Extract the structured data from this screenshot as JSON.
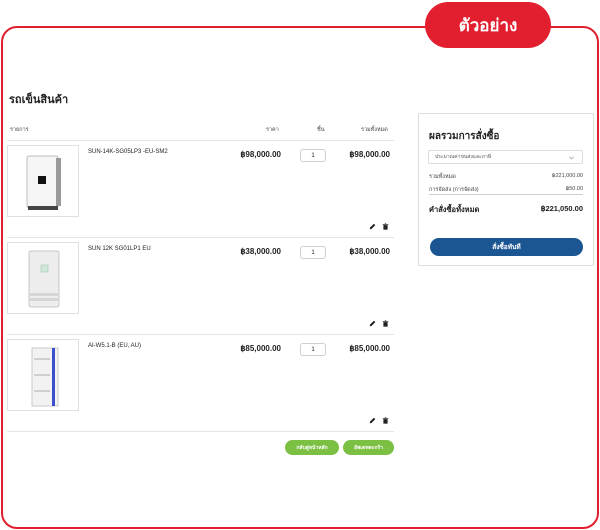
{
  "badge": {
    "label": "ตัวอย่าง"
  },
  "cart": {
    "title": "รถเข็นสินค้า",
    "columns": {
      "item": "รายการ",
      "price": "ราคา",
      "qty": "ชิ้น",
      "total": "รวมทั้งหมด"
    },
    "items": [
      {
        "name": "SUN-14K-SG05LP3 -EU-SM2",
        "price": "฿98,000.00",
        "qty": "1",
        "total": "฿98,000.00",
        "image_icon": "inverter-black-screen"
      },
      {
        "name": "SUN 12K SG01LP1 EU",
        "price": "฿38,000.00",
        "qty": "1",
        "total": "฿38,000.00",
        "image_icon": "inverter-gray"
      },
      {
        "name": "AI-W5.1-B (EU, AU)",
        "price": "฿85,000.00",
        "qty": "1",
        "total": "฿85,000.00",
        "image_icon": "battery-rack"
      }
    ],
    "back_button": "กลับสู่หน้าหลัก",
    "update_button": "อัพเดทตะกร้า"
  },
  "summary": {
    "title": "ผลรวมการสั่งซื้อ",
    "shipping_select": "ประมาณค่าขนส่งและภาษี",
    "subtotal_label": "รวมทั้งหมด",
    "subtotal_value": "฿221,000.00",
    "shipping_label": "การจัดส่ง (การจัดส่ง)",
    "shipping_value": "฿50.00",
    "grand_total_label": "คำสั่งซื้อทั้งหมด",
    "grand_total_value": "฿221,050.00",
    "checkout_button": "สั่งซื้อทันที"
  },
  "colors": {
    "accent_red": "#e21f2f",
    "green": "#7bc043",
    "navy": "#1b5592"
  }
}
